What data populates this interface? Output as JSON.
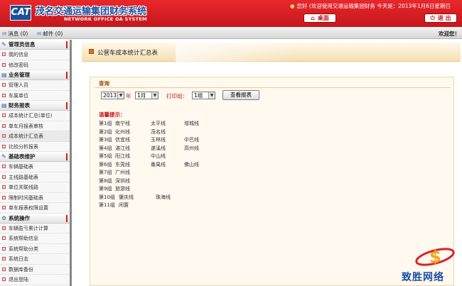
{
  "header": {
    "logo_text": "CAT",
    "title": "茂名交通运输集团财务系统",
    "subtitle": "NETWORK OFFICE OA SYSTEM",
    "welcome": "您好 (欢迎使用交通运输集团财务    今天是：2013年1月6日星期日",
    "home_label": "桌面",
    "exit_label": "退 出"
  },
  "toolbar": {
    "messages_label": "消息 (0)",
    "mail_label": "邮件 (0)",
    "welcome": "欢迎您！"
  },
  "sidebar": {
    "groups": [
      {
        "title": "管理员信息",
        "items": [
          "我的信息",
          "修改密码"
        ]
      },
      {
        "title": "业务管理",
        "items": [
          "管理人员",
          "车属单位"
        ]
      },
      {
        "title": "财务报表",
        "items": [
          "成本统计汇总(单位)",
          "单车月报表审核",
          "成本统计汇总表",
          "比较分析报表"
        ]
      },
      {
        "title": "基础表维护",
        "items": [
          "车辆基础表",
          "主线路基础表",
          "单位关联线路",
          "限制时间基础表",
          "单车报表权限设置"
        ]
      },
      {
        "title": "系统操作",
        "items": [
          "车辆盈亏累计计算",
          "系统帮助信息",
          "系统帮助分类",
          "系统日志",
          "数据库备份",
          "退出登陆"
        ]
      }
    ]
  },
  "main": {
    "title": "公营车成本统计汇总表",
    "query_label": "查询",
    "year_value": "2013",
    "year_unit": "年",
    "month_value": "1月",
    "group_label": "打印组：",
    "group_value": "1组",
    "report_button": "查看报表",
    "tip_title": "温馨提示：",
    "tips": [
      {
        "group": "第1组",
        "names": [
          "南宁线",
          "太平线",
          "增城线"
        ]
      },
      {
        "group": "第2组",
        "names": [
          "化州线",
          "茂名线"
        ]
      },
      {
        "group": "第3组",
        "names": [
          "信宜线",
          "玉林线",
          "中巴线"
        ]
      },
      {
        "group": "第4组",
        "names": [
          "湛江线",
          "遂溪线",
          "高州线"
        ]
      },
      {
        "group": "第5组",
        "names": [
          "阳江线",
          "中山线"
        ]
      },
      {
        "group": "第6组",
        "names": [
          "东莞线",
          "番禺线",
          "佛山线"
        ]
      },
      {
        "group": "第7组",
        "names": [
          "广州线"
        ]
      },
      {
        "group": "第8组",
        "names": [
          "深圳线"
        ]
      },
      {
        "group": "第9组",
        "names": [
          "旅游线"
        ]
      },
      {
        "group": "第10组",
        "names": [
          "肇庆线",
          "珠海线"
        ]
      },
      {
        "group": "第11组",
        "names": [
          "闲置"
        ]
      }
    ]
  },
  "watermark": {
    "text": "致胜网络"
  },
  "colors": {
    "header_red": "#d61f24",
    "accent_blue": "#1b4f9c",
    "title_orange": "#e4711c"
  }
}
